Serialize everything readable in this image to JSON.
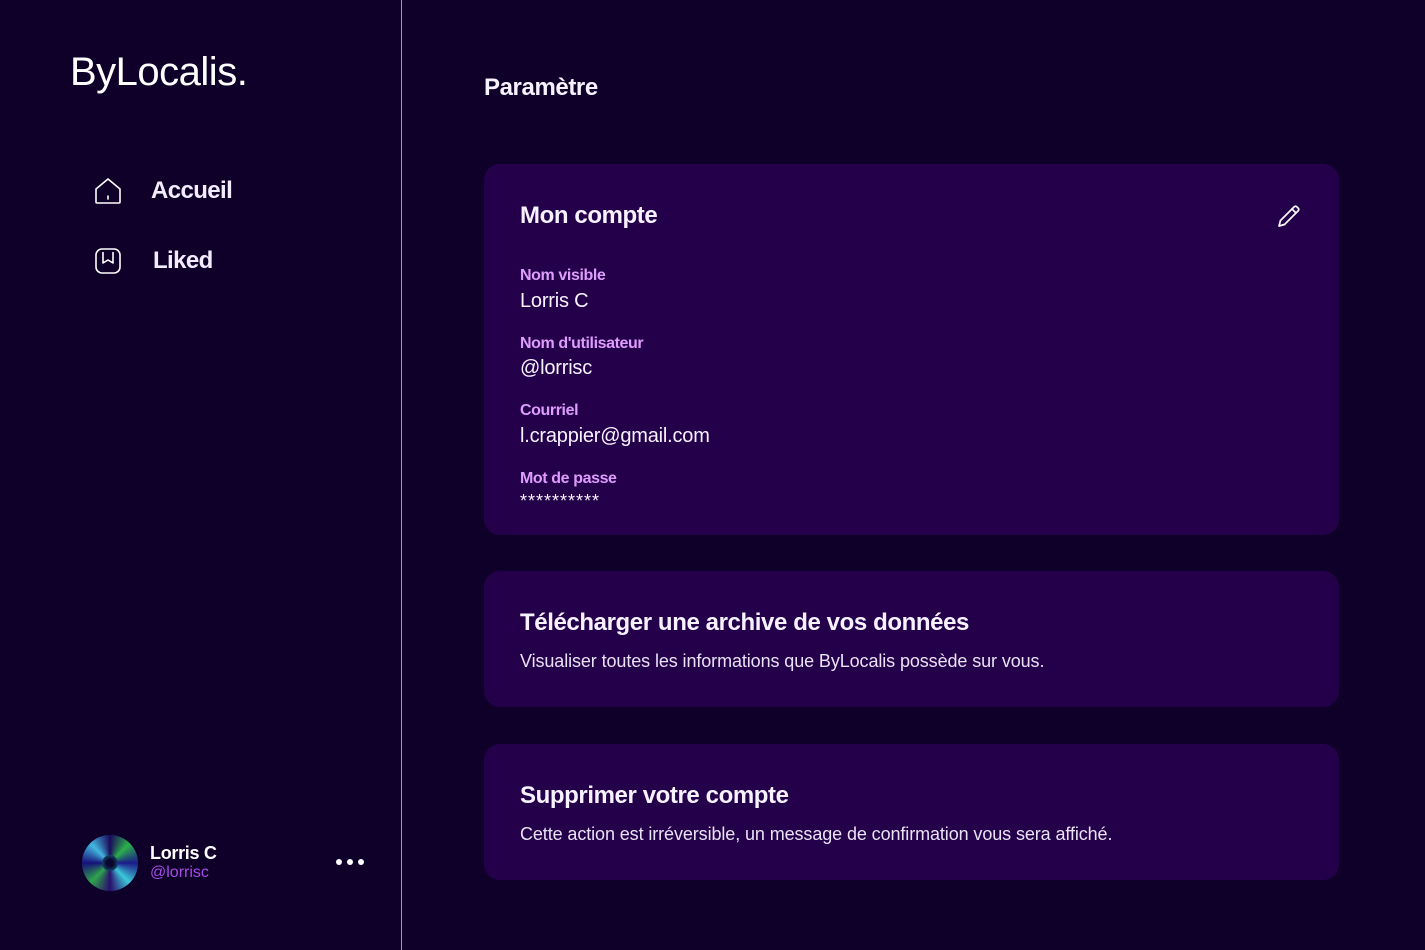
{
  "app": {
    "logo": "ByLocalis."
  },
  "sidebar": {
    "items": [
      {
        "label": "Accueil",
        "icon": "home-icon"
      },
      {
        "label": "Liked",
        "icon": "bookmark-icon"
      }
    ],
    "profile": {
      "name": "Lorris C",
      "handle": "@lorrisc"
    }
  },
  "main": {
    "title": "Paramètre",
    "account": {
      "title": "Mon compte",
      "fields": [
        {
          "label": "Nom visible",
          "value": "Lorris C"
        },
        {
          "label": "Nom d'utilisateur",
          "value": "@lorrisc"
        },
        {
          "label": "Courriel",
          "value": "l.crappier@gmail.com"
        },
        {
          "label": "Mot de passe",
          "value": "**********"
        }
      ]
    },
    "archive": {
      "title": "Télécharger une archive de vos données",
      "description": "Visualiser toutes les informations que ByLocalis possède sur vous."
    },
    "delete": {
      "title": "Supprimer votre compte",
      "description": "Cette action est irréversible, un message de confirmation vous sera affiché."
    }
  },
  "colors": {
    "background": "#0f0029",
    "card": "#25004a",
    "accent": "#df9cff",
    "handle": "#a64ce8",
    "divider": "#b48cd6"
  }
}
